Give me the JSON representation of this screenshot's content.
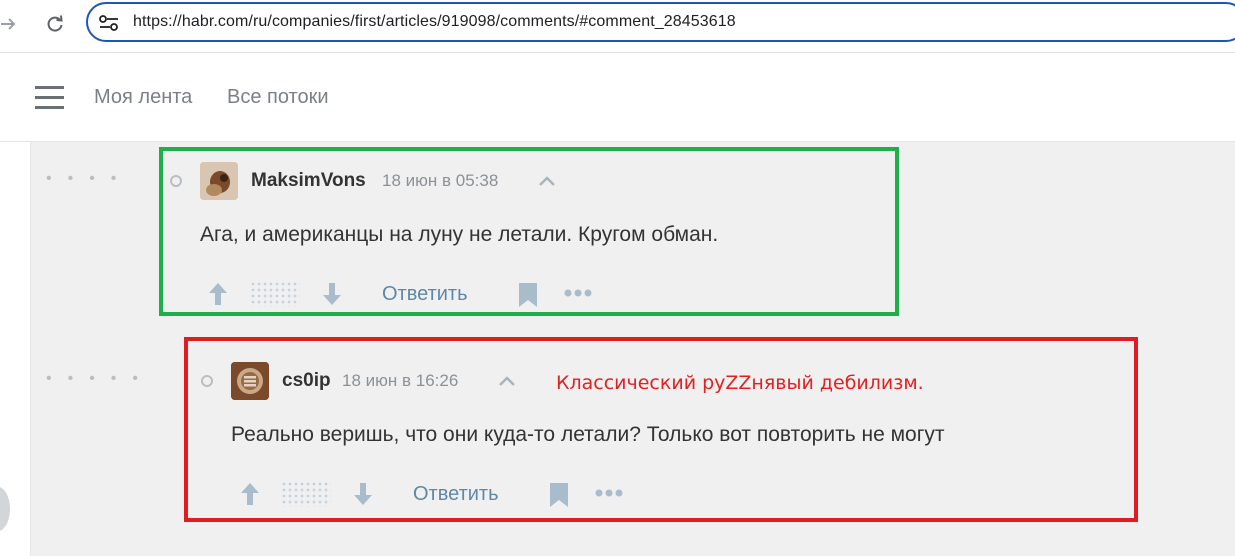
{
  "browser": {
    "url": "https://habr.com/ru/companies/first/articles/919098/comments/#comment_28453618"
  },
  "site_nav": {
    "links": [
      "Моя лента",
      "Все потоки"
    ]
  },
  "comments": [
    {
      "author": "MaksimVons",
      "time": "18 июн в 05:38",
      "text": "Ага, и американцы на луну не летали. Кругом обман.",
      "reply_label": "Ответить"
    },
    {
      "author": "cs0ip",
      "time": "18 июн в 16:26",
      "text": "Реально веришь, что они куда-то летали? Только вот повторить не могут",
      "reply_label": "Ответить"
    }
  ],
  "annotation": {
    "text": "Классический руZZнявый дебилизм.",
    "color": "#e2201f"
  },
  "highlights": {
    "first_color": "#1fae4a",
    "second_color": "#e01c22"
  }
}
